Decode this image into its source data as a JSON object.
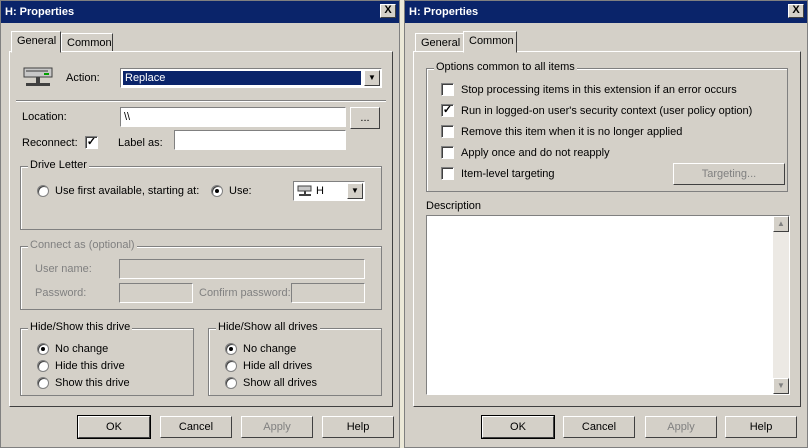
{
  "left": {
    "title": "H: Properties",
    "close_glyph": "X",
    "tabs": [
      "General",
      "Common"
    ],
    "action_label": "Action:",
    "action_value": "Replace",
    "location_label": "Location:",
    "location_value": "\\\\ ",
    "browse_label": "...",
    "reconnect_label": "Reconnect:",
    "reconnect_mark": "✓",
    "label_as_label": "Label as:",
    "label_as_value": "",
    "drive_letter": {
      "legend": "Drive Letter",
      "first_available_label": "Use first available, starting at:",
      "use_label": "Use:",
      "use_value": "H"
    },
    "connect_as": {
      "legend": "Connect as (optional)",
      "username_label": "User name:",
      "password_label": "Password:",
      "confirm_label": "Confirm password:"
    },
    "hide_show_drive": {
      "legend": "Hide/Show this drive",
      "options": [
        "No change",
        "Hide this drive",
        "Show this drive"
      ]
    },
    "hide_show_all": {
      "legend": "Hide/Show all drives",
      "options": [
        "No change",
        "Hide all drives",
        "Show all drives"
      ]
    },
    "buttons": {
      "ok": "OK",
      "cancel": "Cancel",
      "apply": "Apply",
      "help": "Help"
    }
  },
  "right": {
    "title": "H: Properties",
    "close_glyph": "X",
    "tabs": [
      "General",
      "Common"
    ],
    "options_legend": "Options common to all items",
    "options": [
      {
        "label": "Stop processing items in this extension if an error occurs",
        "checked": false
      },
      {
        "label": "Run in logged-on user's security context (user policy option)",
        "checked": true
      },
      {
        "label": "Remove this item when it is no longer applied",
        "checked": false
      },
      {
        "label": "Apply once and do not reapply",
        "checked": false
      },
      {
        "label": "Item-level targeting",
        "checked": false
      }
    ],
    "check_mark": "✓",
    "targeting_label": "Targeting...",
    "description_label": "Description",
    "scroll_up": "▲",
    "scroll_down": "▼",
    "buttons": {
      "ok": "OK",
      "cancel": "Cancel",
      "apply": "Apply",
      "help": "Help"
    }
  },
  "colors": {
    "titlebar": "#0a246a",
    "face": "#d4d0c8",
    "selection": "#0a246a"
  }
}
